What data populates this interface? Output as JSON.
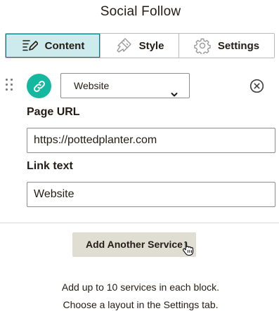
{
  "panel": {
    "title": "Social Follow"
  },
  "tabs": [
    {
      "label": "Content",
      "icon": "pencil-icon",
      "active": true
    },
    {
      "label": "Style",
      "icon": "brush-icon",
      "active": false
    },
    {
      "label": "Settings",
      "icon": "gear-icon",
      "active": false
    }
  ],
  "service": {
    "icon": "link-icon",
    "icon_color": "#14b89f",
    "selected": "Website",
    "url_label": "Page URL",
    "url_value": "https://pottedplanter.com",
    "link_text_label": "Link text",
    "link_text_value": "Website"
  },
  "actions": {
    "add_service_label": "Add Another Service"
  },
  "help": {
    "line1": "Add up to 10 services in each block.",
    "line2": "Choose a layout in the Settings tab."
  },
  "colors": {
    "accent": "#007c89",
    "active_tab_bg": "#cdeaec",
    "button_bg": "#e0ddd2"
  }
}
